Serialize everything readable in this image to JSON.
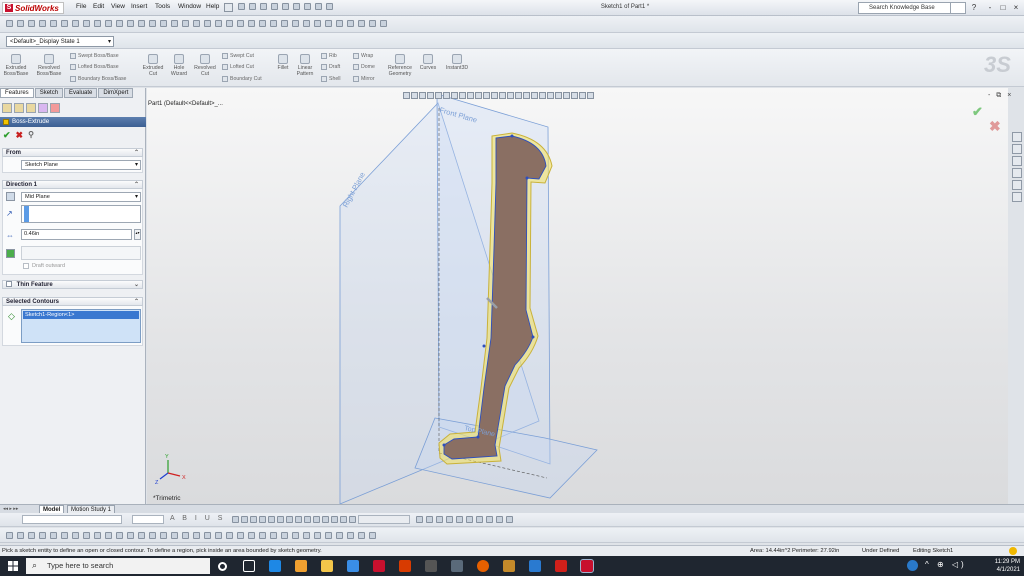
{
  "app": {
    "name": "SolidWorks",
    "document_title": "Sketch1 of Part1 *"
  },
  "menu": [
    "File",
    "Edit",
    "View",
    "Insert",
    "Tools",
    "Window",
    "Help"
  ],
  "search": {
    "placeholder": "Search Knowledge Base"
  },
  "window_controls": {
    "help": "?",
    "minimize": "-",
    "restore": "□",
    "close": "×"
  },
  "config_selector": {
    "value": "<Default>_Display State 1"
  },
  "command_manager": {
    "large": [
      {
        "label": "Extruded Boss/Base"
      },
      {
        "label": "Revolved Boss/Base"
      },
      {
        "label": "Extruded Cut"
      },
      {
        "label": "Hole Wizard"
      },
      {
        "label": "Revolved Cut"
      },
      {
        "label": "Fillet"
      },
      {
        "label": "Linear Pattern"
      },
      {
        "label": "Reference Geometry"
      },
      {
        "label": "Curves"
      },
      {
        "label": "Instant3D"
      }
    ],
    "small": [
      {
        "label": "Swept Boss/Base"
      },
      {
        "label": "Lofted Boss/Base"
      },
      {
        "label": "Boundary Boss/Base"
      },
      {
        "label": "Swept Cut"
      },
      {
        "label": "Lofted Cut"
      },
      {
        "label": "Boundary Cut"
      },
      {
        "label": "Rib"
      },
      {
        "label": "Draft"
      },
      {
        "label": "Shell"
      },
      {
        "label": "Wrap"
      },
      {
        "label": "Dome"
      },
      {
        "label": "Mirror"
      }
    ]
  },
  "left_tabs": [
    "Features",
    "Sketch",
    "Evaluate",
    "DimXpert"
  ],
  "property_manager": {
    "title": "Boss-Extrude",
    "ok": "✔",
    "cancel": "✖",
    "pin": "⚲",
    "from": {
      "header": "From",
      "value": "Sketch Plane"
    },
    "direction1": {
      "header": "Direction 1",
      "type": "Mid Plane",
      "depth": "0.46in",
      "draft_label": "Draft outward"
    },
    "thin_feature": {
      "header": "Thin Feature"
    },
    "selected_contours": {
      "header": "Selected Contours",
      "item": "Sketch1-Region<1>"
    }
  },
  "graphics": {
    "tree_root": "Part1 (Default<<Default>_...",
    "view_name": "*Trimetric",
    "confirm_ok": "✔",
    "confirm_cancel": "✖",
    "planes": {
      "front": "Front Plane",
      "right": "Right Plane",
      "top": "Top Plane"
    },
    "triad": {
      "x": "X",
      "y": "Y",
      "z": "Z"
    },
    "win_ctl": "- ⧉ ×"
  },
  "bottom_tabs": [
    "Model",
    "Motion Study 1"
  ],
  "status": {
    "message": "Pick a sketch entity to define an open or closed contour. To define a region, pick inside an area bounded by sketch geometry.",
    "measure": "Area: 14.44in^2 Perimeter: 27.92in",
    "state": "Under Defined",
    "mode": "Editing Sketch1"
  },
  "taskbar": {
    "search_placeholder": "Type here to search",
    "time": "11:29 PM",
    "date": "4/1/2021"
  },
  "colors": {
    "accent": "#3c5f93",
    "face": "#8a6f63",
    "edge": "#f5e15a",
    "plane": "#7b9fd6"
  }
}
